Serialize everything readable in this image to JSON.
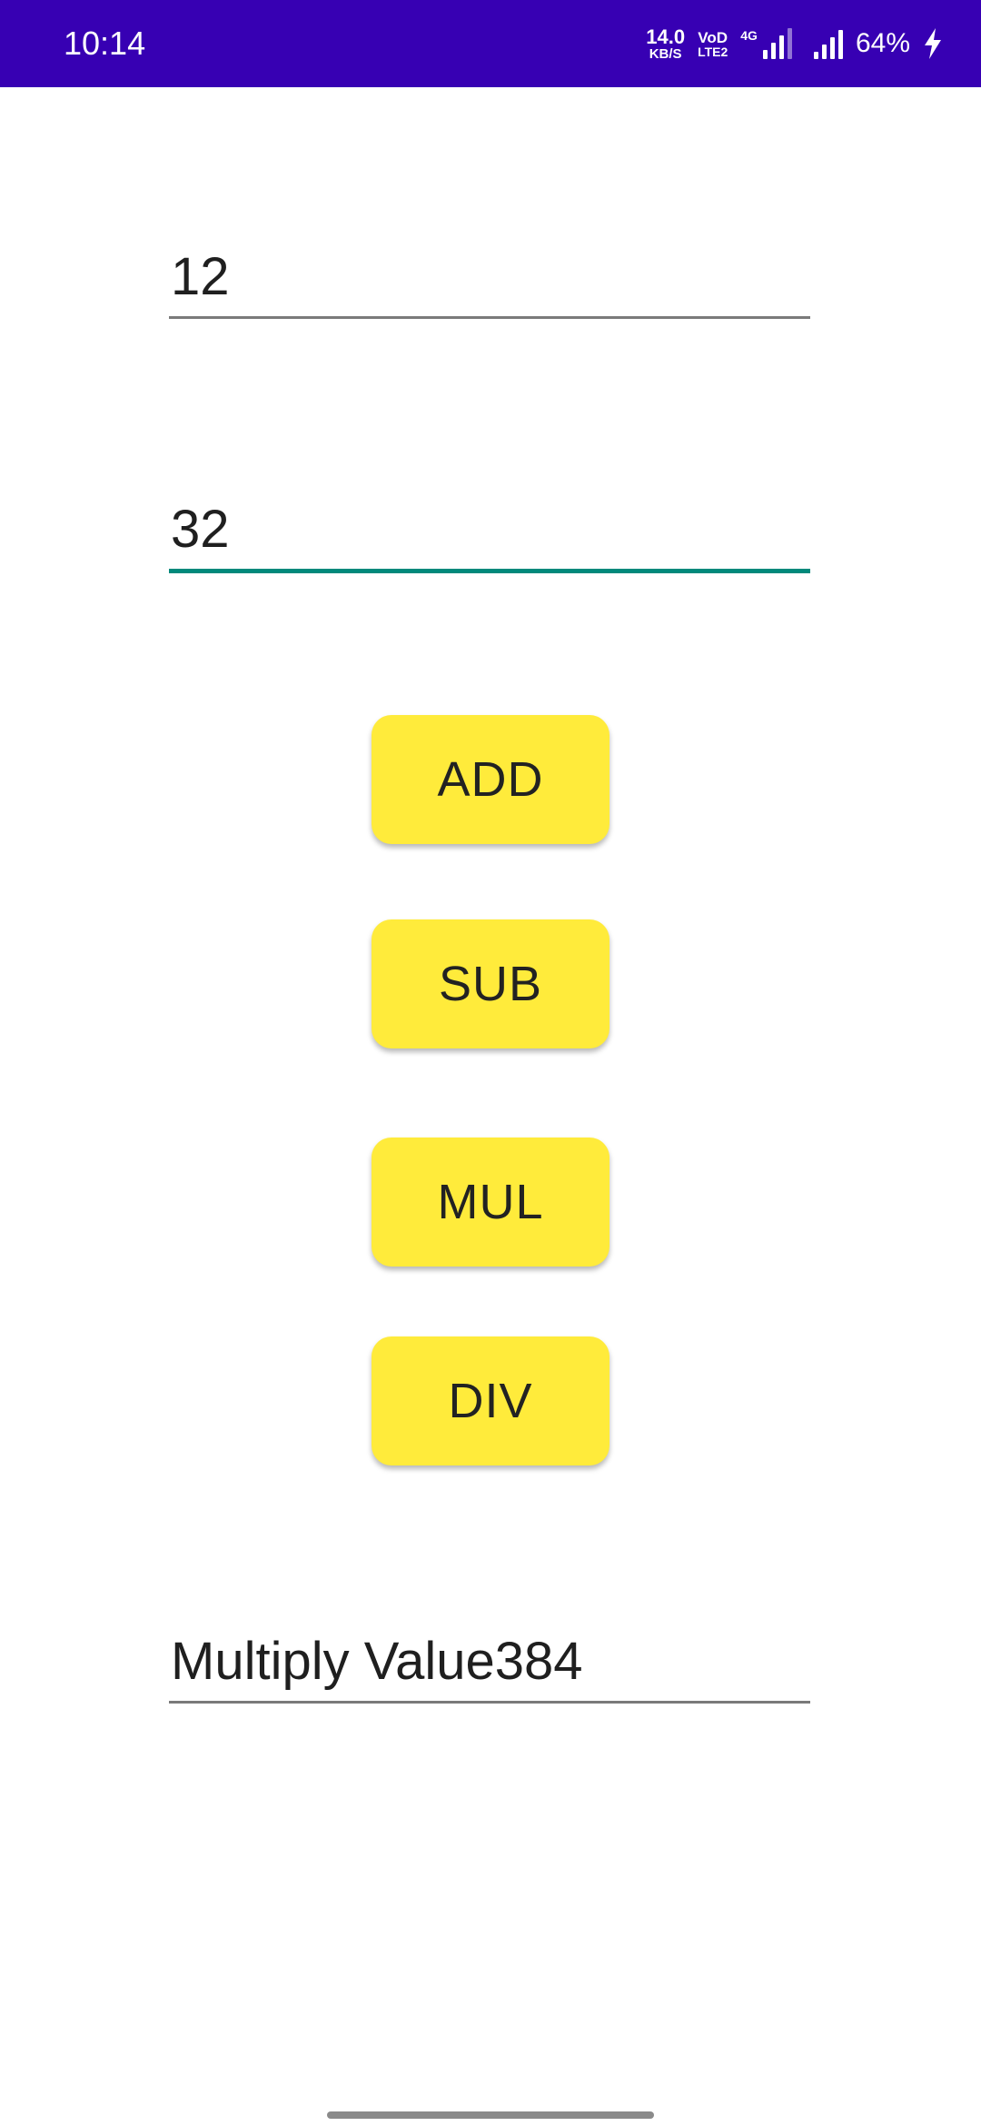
{
  "status_bar": {
    "time": "10:14",
    "net_speed_value": "14.0",
    "net_speed_unit": "KB/S",
    "volte_top": "VoD",
    "volte_bottom": "LTE2",
    "signal_tag": "4G",
    "battery_percent": "64%",
    "background_color": "#3700B3",
    "icons": [
      "network-speed-icon",
      "volte-icon",
      "signal-4g-icon",
      "signal-icon",
      "charging-bolt-icon"
    ]
  },
  "inputs": {
    "first_number": "12",
    "second_number": "32",
    "focused_color": "#00897B"
  },
  "buttons": {
    "add_label": "ADD",
    "sub_label": "SUB",
    "mul_label": "MUL",
    "div_label": "DIV",
    "color": "#FFEB3B"
  },
  "result": {
    "text": "Multiply Value384"
  }
}
